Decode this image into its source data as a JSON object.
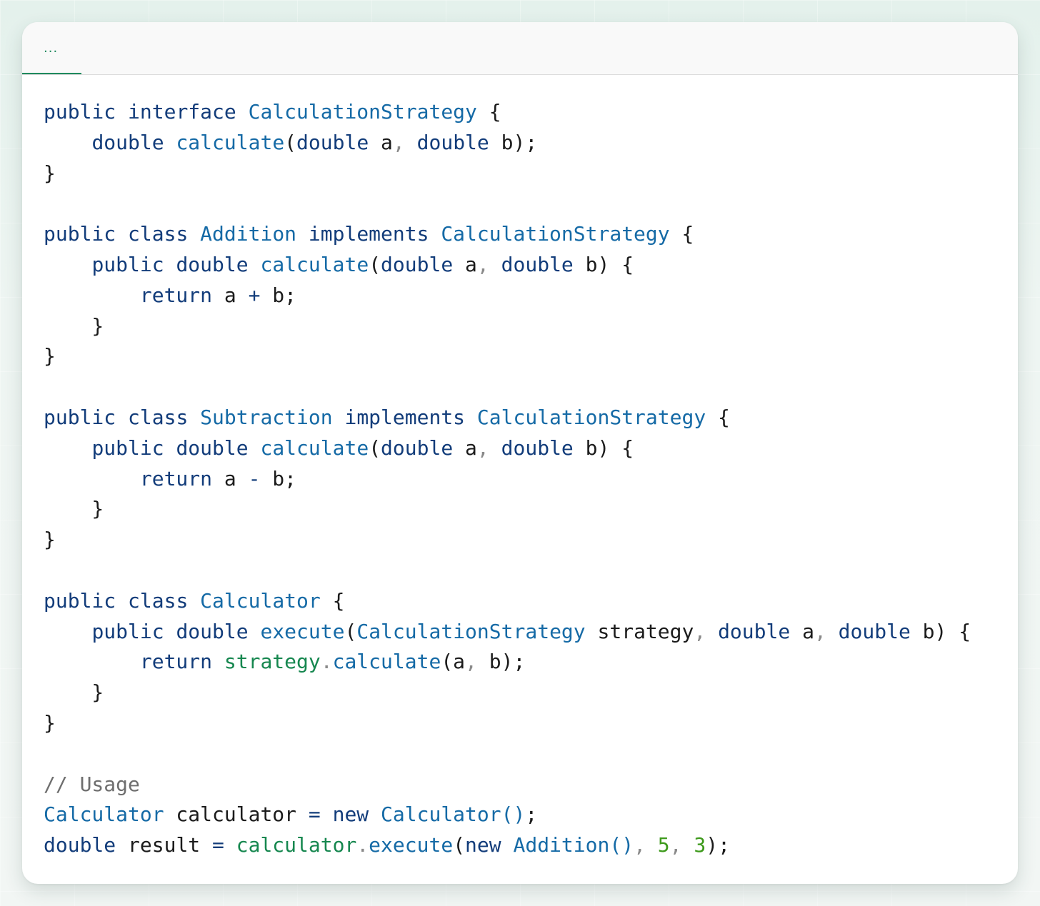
{
  "tab": {
    "label": "..."
  },
  "code": {
    "language": "java",
    "lines": [
      [
        [
          "kw",
          "public"
        ],
        [
          "",
          " "
        ],
        [
          "kw",
          "interface"
        ],
        [
          "",
          " "
        ],
        [
          "ty",
          "CalculationStrategy"
        ],
        [
          "",
          " {"
        ]
      ],
      [
        [
          "",
          "    "
        ],
        [
          "kw",
          "double"
        ],
        [
          "",
          " "
        ],
        [
          "fn",
          "calculate"
        ],
        [
          "",
          "("
        ],
        [
          "kw",
          "double"
        ],
        [
          "",
          " a"
        ],
        [
          "punc",
          ","
        ],
        [
          "",
          " "
        ],
        [
          "kw",
          "double"
        ],
        [
          "",
          " b);"
        ]
      ],
      [
        [
          "",
          "}"
        ]
      ],
      [],
      [
        [
          "kw",
          "public"
        ],
        [
          "",
          " "
        ],
        [
          "kw",
          "class"
        ],
        [
          "",
          " "
        ],
        [
          "ty",
          "Addition"
        ],
        [
          "",
          " "
        ],
        [
          "kw",
          "implements"
        ],
        [
          "",
          " "
        ],
        [
          "ty",
          "CalculationStrategy"
        ],
        [
          "",
          " {"
        ]
      ],
      [
        [
          "",
          "    "
        ],
        [
          "kw",
          "public"
        ],
        [
          "",
          " "
        ],
        [
          "kw",
          "double"
        ],
        [
          "",
          " "
        ],
        [
          "fn",
          "calculate"
        ],
        [
          "",
          "("
        ],
        [
          "kw",
          "double"
        ],
        [
          "",
          " a"
        ],
        [
          "punc",
          ","
        ],
        [
          "",
          " "
        ],
        [
          "kw",
          "double"
        ],
        [
          "",
          " b) {"
        ]
      ],
      [
        [
          "",
          "        "
        ],
        [
          "kw",
          "return"
        ],
        [
          "",
          " a "
        ],
        [
          "op",
          "+"
        ],
        [
          "",
          " b;"
        ]
      ],
      [
        [
          "",
          "    }"
        ]
      ],
      [
        [
          "",
          "}"
        ]
      ],
      [],
      [
        [
          "kw",
          "public"
        ],
        [
          "",
          " "
        ],
        [
          "kw",
          "class"
        ],
        [
          "",
          " "
        ],
        [
          "ty",
          "Subtraction"
        ],
        [
          "",
          " "
        ],
        [
          "kw",
          "implements"
        ],
        [
          "",
          " "
        ],
        [
          "ty",
          "CalculationStrategy"
        ],
        [
          "",
          " {"
        ]
      ],
      [
        [
          "",
          "    "
        ],
        [
          "kw",
          "public"
        ],
        [
          "",
          " "
        ],
        [
          "kw",
          "double"
        ],
        [
          "",
          " "
        ],
        [
          "fn",
          "calculate"
        ],
        [
          "",
          "("
        ],
        [
          "kw",
          "double"
        ],
        [
          "",
          " a"
        ],
        [
          "punc",
          ","
        ],
        [
          "",
          " "
        ],
        [
          "kw",
          "double"
        ],
        [
          "",
          " b) {"
        ]
      ],
      [
        [
          "",
          "        "
        ],
        [
          "kw",
          "return"
        ],
        [
          "",
          " a "
        ],
        [
          "op",
          "-"
        ],
        [
          "",
          " b;"
        ]
      ],
      [
        [
          "",
          "    }"
        ]
      ],
      [
        [
          "",
          "}"
        ]
      ],
      [],
      [
        [
          "kw",
          "public"
        ],
        [
          "",
          " "
        ],
        [
          "kw",
          "class"
        ],
        [
          "",
          " "
        ],
        [
          "ty",
          "Calculator"
        ],
        [
          "",
          " {"
        ]
      ],
      [
        [
          "",
          "    "
        ],
        [
          "kw",
          "public"
        ],
        [
          "",
          " "
        ],
        [
          "kw",
          "double"
        ],
        [
          "",
          " "
        ],
        [
          "fn",
          "execute"
        ],
        [
          "",
          "("
        ],
        [
          "ty",
          "CalculationStrategy"
        ],
        [
          "",
          " strategy"
        ],
        [
          "punc",
          ","
        ],
        [
          "",
          " "
        ],
        [
          "kw",
          "double"
        ],
        [
          "",
          " a"
        ],
        [
          "punc",
          ","
        ],
        [
          "",
          " "
        ],
        [
          "kw",
          "double"
        ],
        [
          "",
          " b) {"
        ]
      ],
      [
        [
          "",
          "        "
        ],
        [
          "kw",
          "return"
        ],
        [
          "",
          " "
        ],
        [
          "var",
          "strategy"
        ],
        [
          "punc",
          "."
        ],
        [
          "fn",
          "calculate"
        ],
        [
          "",
          "(a"
        ],
        [
          "punc",
          ","
        ],
        [
          "",
          " b);"
        ]
      ],
      [
        [
          "",
          "    }"
        ]
      ],
      [
        [
          "",
          "}"
        ]
      ],
      [],
      [
        [
          "cm",
          "// Usage"
        ]
      ],
      [
        [
          "ty",
          "Calculator"
        ],
        [
          "",
          " calculator "
        ],
        [
          "op",
          "="
        ],
        [
          "",
          " "
        ],
        [
          "kw",
          "new"
        ],
        [
          "",
          " "
        ],
        [
          "ty",
          "Calculator()"
        ],
        [
          "",
          ";"
        ]
      ],
      [
        [
          "kw",
          "double"
        ],
        [
          "",
          " result "
        ],
        [
          "op",
          "="
        ],
        [
          "",
          " "
        ],
        [
          "var",
          "calculator"
        ],
        [
          "punc",
          "."
        ],
        [
          "fn",
          "execute"
        ],
        [
          "",
          "("
        ],
        [
          "kw",
          "new"
        ],
        [
          "",
          " "
        ],
        [
          "ty",
          "Addition()"
        ],
        [
          "punc",
          ","
        ],
        [
          "",
          " "
        ],
        [
          "num",
          "5"
        ],
        [
          "punc",
          ","
        ],
        [
          "",
          " "
        ],
        [
          "num",
          "3"
        ],
        [
          "",
          ");"
        ]
      ]
    ]
  }
}
